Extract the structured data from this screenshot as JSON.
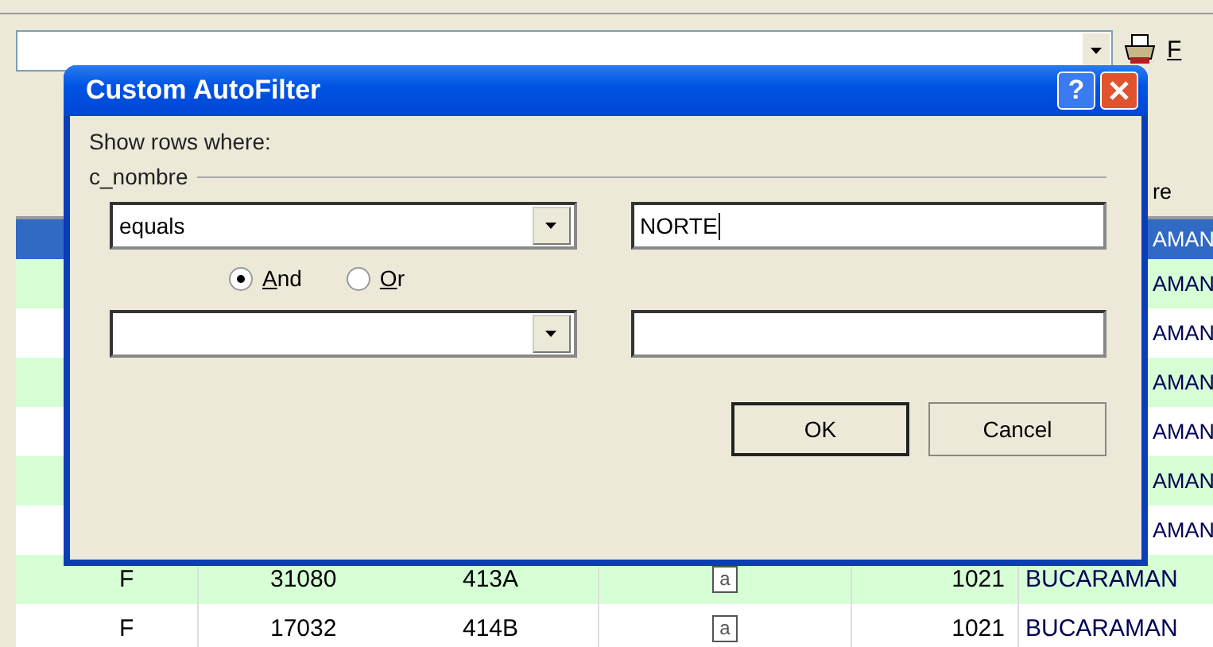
{
  "toolbar": {
    "menu_label": "F"
  },
  "grid": {
    "header": {
      "column_6": "re"
    },
    "rows": [
      {
        "selected": true,
        "column_6": "AMAN"
      },
      {
        "selected": false,
        "column_6": "AMAN"
      },
      {
        "selected": false,
        "column_6": "AMAN"
      },
      {
        "selected": false,
        "column_6": "AMAN"
      },
      {
        "selected": false,
        "column_6": "AMAN"
      },
      {
        "selected": false,
        "column_6": "AMAN"
      },
      {
        "selected": false,
        "column_6": "AMAN"
      },
      {
        "selected": false,
        "column_1": "F",
        "column_2": "31080",
        "column_3": "413A",
        "column_4": "a",
        "column_5": "1021",
        "column_6": "BUCARAMAN"
      },
      {
        "selected": false,
        "column_1": "F",
        "column_2": "17032",
        "column_3": "414B",
        "column_4": "a",
        "column_5": "1021",
        "column_6": "BUCARAMAN"
      }
    ]
  },
  "dialog": {
    "title": "Custom AutoFilter",
    "help_glyph": "?",
    "prompt": "Show rows where:",
    "group": "c_nombre",
    "conditions": [
      {
        "operator": "equals",
        "value": "NORTE",
        "focused": true
      },
      {
        "focused": false
      }
    ],
    "joins": [
      {
        "label": "And",
        "selected": true
      },
      {
        "label": "Or",
        "selected": false
      }
    ],
    "buttons": [
      {
        "label": "OK",
        "default": true
      },
      {
        "label": "Cancel",
        "default": false
      }
    ]
  }
}
